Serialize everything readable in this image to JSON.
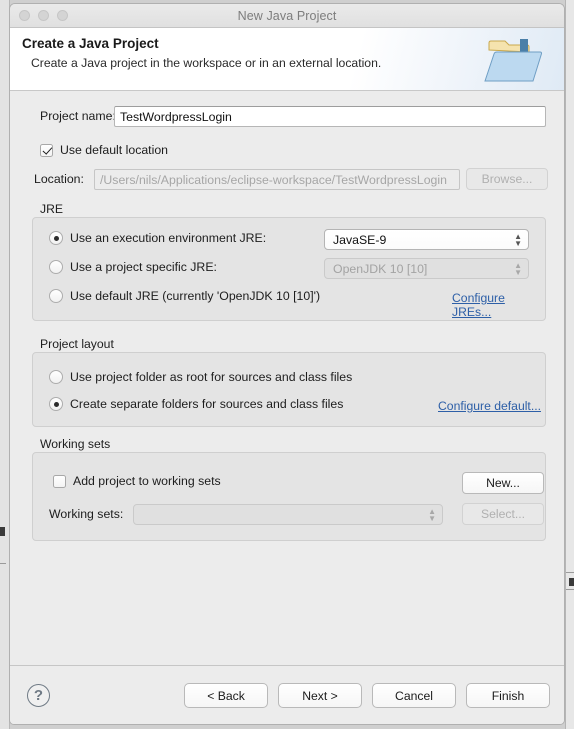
{
  "window": {
    "title": "New Java Project",
    "traffic_lights": [
      "close-button",
      "minimize-button",
      "zoom-button"
    ]
  },
  "banner": {
    "title": "Create a Java Project",
    "subtitle": "Create a Java project in the workspace or in an external location.",
    "icon": "java-project-folder-icon"
  },
  "project": {
    "name_label": "Project name:",
    "name_value": "TestWordpressLogin",
    "use_default_location_label": "Use default location",
    "use_default_location_checked": true,
    "location_label": "Location:",
    "location_value": "/Users/nils/Applications/eclipse-workspace/TestWordpressLogin",
    "browse_label": "Browse...",
    "browse_enabled": false
  },
  "jre": {
    "group_title": "JRE",
    "options": [
      {
        "label": "Use an execution environment JRE:",
        "selected": true,
        "combo_value": "JavaSE-9",
        "combo_enabled": true
      },
      {
        "label": "Use a project specific JRE:",
        "selected": false,
        "combo_value": "OpenJDK 10 [10]",
        "combo_enabled": false
      },
      {
        "label": "Use default JRE (currently 'OpenJDK 10 [10]')",
        "selected": false
      }
    ],
    "configure_link": "Configure JREs..."
  },
  "layout": {
    "group_title": "Project layout",
    "options": [
      {
        "label": "Use project folder as root for sources and class files",
        "selected": false
      },
      {
        "label": "Create separate folders for sources and class files",
        "selected": true
      }
    ],
    "configure_link": "Configure default..."
  },
  "working_sets": {
    "group_title": "Working sets",
    "add_label": "Add project to working sets",
    "add_checked": false,
    "new_label": "New...",
    "new_enabled": true,
    "sets_label": "Working sets:",
    "sets_value": "",
    "sets_enabled": false,
    "select_label": "Select...",
    "select_enabled": false
  },
  "footer": {
    "help_label": "?",
    "buttons": [
      {
        "label": "< Back",
        "enabled": true
      },
      {
        "label": "Next >",
        "enabled": true
      },
      {
        "label": "Cancel",
        "enabled": true
      },
      {
        "label": "Finish",
        "enabled": true
      }
    ]
  },
  "colors": {
    "dialog_bg": "#ececec",
    "group_bg": "#e4e4e4",
    "link": "#2d5fa7",
    "title_text": "#7d7d7d"
  }
}
